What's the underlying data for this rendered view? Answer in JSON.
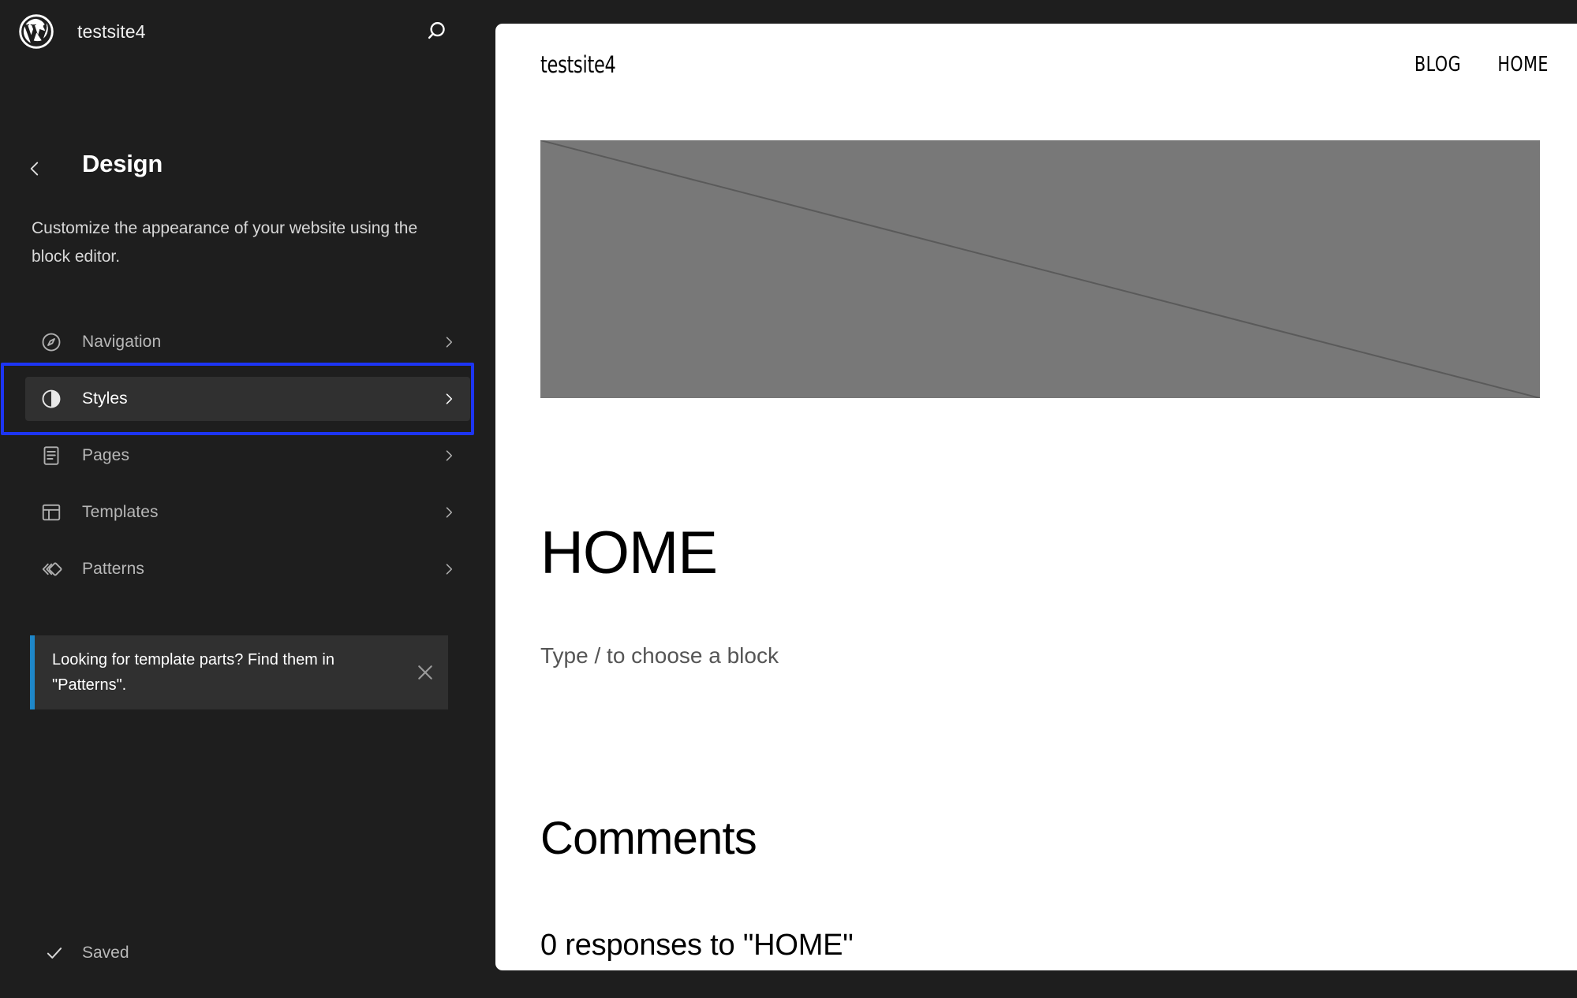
{
  "sidebar": {
    "logo_icon": "wordpress-logo-icon",
    "site_title": "testsite4",
    "search_icon": "search-icon",
    "back_icon": "chevron-left-icon",
    "page_title": "Design",
    "description": "Customize the appearance of your website using the block editor.",
    "menu": [
      {
        "label": "Navigation",
        "icon": "compass-icon",
        "selected": false
      },
      {
        "label": "Styles",
        "icon": "contrast-icon",
        "selected": true
      },
      {
        "label": "Pages",
        "icon": "page-icon",
        "selected": false
      },
      {
        "label": "Templates",
        "icon": "layout-icon",
        "selected": false
      },
      {
        "label": "Patterns",
        "icon": "patterns-icon",
        "selected": false
      }
    ],
    "notice": {
      "text": "Looking for template parts? Find them in \"Patterns\".",
      "close_icon": "close-icon",
      "accent_color": "#1e87c9"
    },
    "status": {
      "check_icon": "check-icon",
      "label": "Saved"
    },
    "focus_highlight_color": "#1d35f4"
  },
  "canvas": {
    "site_title": "testsite4",
    "nav": [
      {
        "label": "BLOG"
      },
      {
        "label": "HOME"
      }
    ],
    "image_placeholder": {
      "name": "image-placeholder",
      "color": "#787878"
    },
    "page_heading": "HOME",
    "block_placeholder": "Type / to choose a block",
    "comments_heading": "Comments",
    "responses_text": "0 responses to \"HOME\""
  }
}
